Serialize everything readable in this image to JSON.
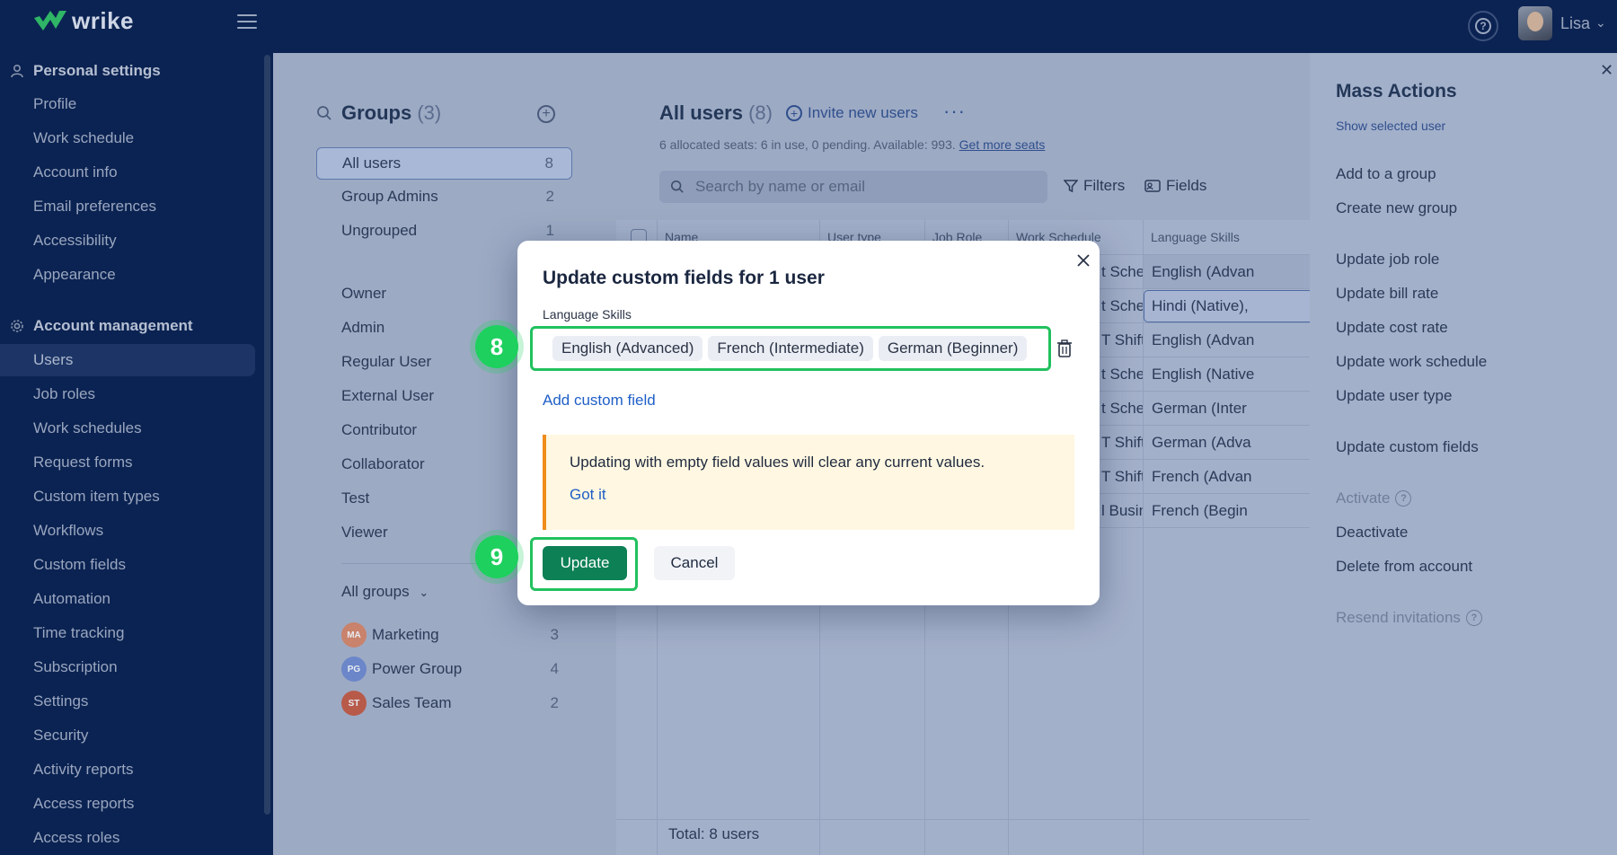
{
  "app": {
    "brand": "wrike",
    "user_name": "Lisa"
  },
  "sidebar": {
    "personal_settings": "Personal settings",
    "personal_items": [
      "Profile",
      "Work schedule",
      "Account info",
      "Email preferences",
      "Accessibility",
      "Appearance"
    ],
    "account_management": "Account management",
    "account_items": [
      "Users",
      "Job roles",
      "Work schedules",
      "Request forms",
      "Custom item types",
      "Workflows",
      "Custom fields",
      "Automation",
      "Time tracking",
      "Subscription",
      "Settings",
      "Security",
      "Activity reports",
      "Access reports",
      "Access roles"
    ],
    "active_item": "Users"
  },
  "groups": {
    "title": "Groups",
    "count": "(3)",
    "items": [
      {
        "label": "All users",
        "count": "8"
      },
      {
        "label": "Group Admins",
        "count": "2"
      },
      {
        "label": "Ungrouped",
        "count": "1"
      }
    ],
    "roles": [
      "Owner",
      "Admin",
      "Regular User",
      "External User",
      "Contributor",
      "Collaborator",
      "Test",
      "Viewer"
    ],
    "all_groups_label": "All groups",
    "group_list": [
      {
        "initials": "MA",
        "name": "Marketing",
        "count": "3",
        "color": "#c9826b"
      },
      {
        "initials": "PG",
        "name": "Power Group",
        "count": "4",
        "color": "#6b86c9"
      },
      {
        "initials": "ST",
        "name": "Sales Team",
        "count": "2",
        "color": "#b85a4a"
      }
    ]
  },
  "users": {
    "title": "All users",
    "count": "(8)",
    "invite_label": "Invite new users",
    "seats_text": "6 allocated seats: 6 in use, 0 pending. Available: 993.",
    "seats_link": "Get more seats",
    "search_placeholder": "Search by name or email",
    "filters_label": "Filters",
    "fields_label": "Fields",
    "columns": [
      "Name",
      "User type",
      "Job Role",
      "Work Schedule",
      "Language Skills"
    ],
    "schedule_col": [
      "t Schedule",
      "t Schedule",
      "T Shift",
      "t Schedule",
      "t Schedule",
      "T Shift",
      "T Shift",
      "l Business H..."
    ],
    "language_col": [
      "English (Advan",
      "Hindi (Native),",
      "English (Advan",
      "English (Native",
      "German (Inter",
      "German (Adva",
      "French (Advan",
      "French (Begin"
    ],
    "total": "Total: 8 users"
  },
  "mass_actions": {
    "title": "Mass Actions",
    "show_selected": "Show selected user",
    "items": [
      "Add to a group",
      "Create new group",
      "Update job role",
      "Update bill rate",
      "Update cost rate",
      "Update work schedule",
      "Update user type",
      "Update custom fields"
    ],
    "activate": "Activate",
    "deactivate": "Deactivate",
    "delete": "Delete from account",
    "resend": "Resend invitations"
  },
  "modal": {
    "title": "Update custom fields for 1 user",
    "field_label": "Language Skills",
    "tags": [
      "English (Advanced)",
      "French (Intermediate)",
      "German (Beginner)"
    ],
    "add_custom_field": "Add custom field",
    "warning_text": "Updating with empty field values will clear any current values.",
    "warning_link": "Got it",
    "update_button": "Update",
    "cancel_button": "Cancel"
  },
  "steps": [
    "8",
    "9"
  ],
  "colors": {
    "accent_green": "#21c15e",
    "update_button": "#0d8056",
    "link_blue": "#1f5fc7",
    "warning_border": "#f08c1c"
  }
}
